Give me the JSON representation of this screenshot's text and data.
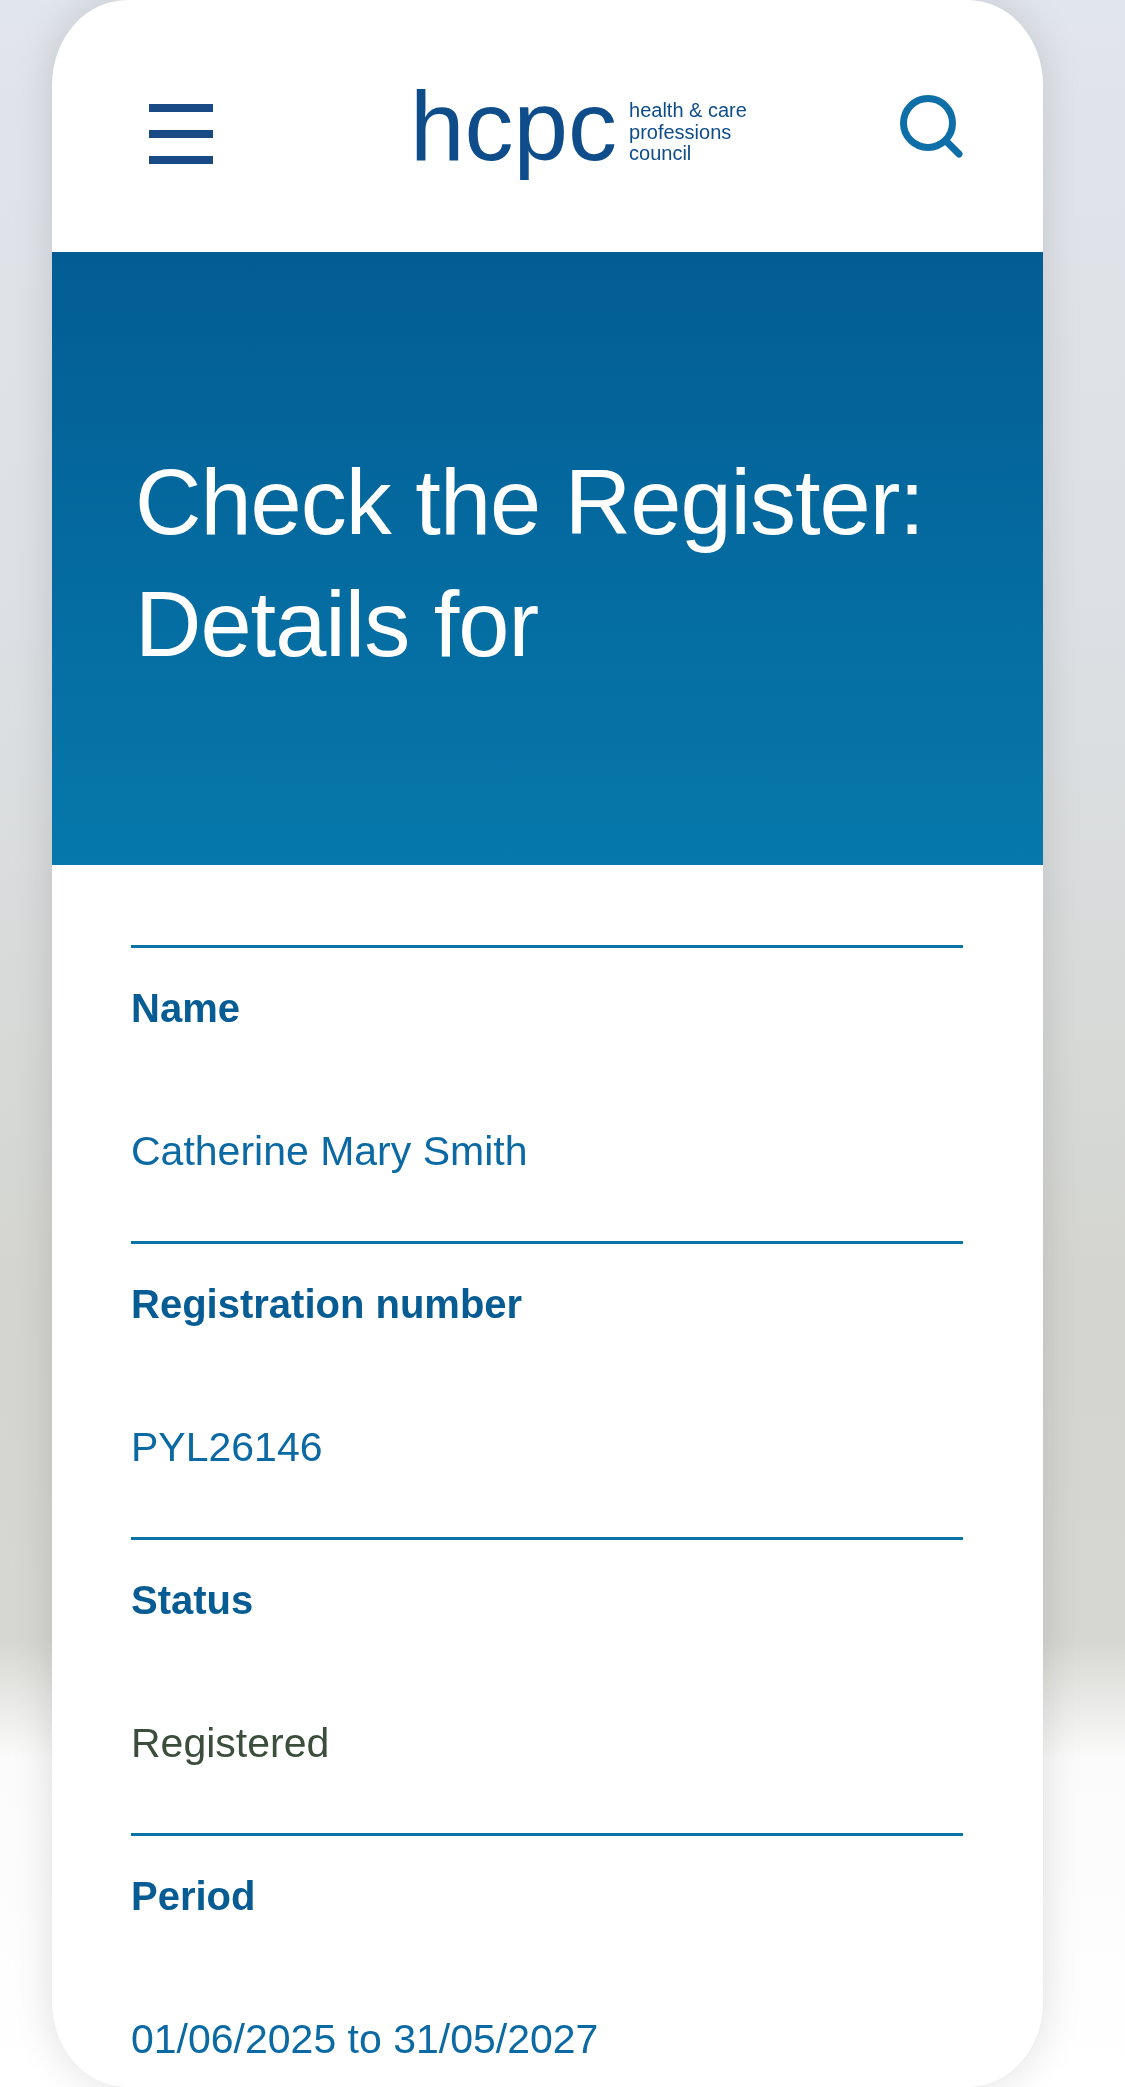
{
  "header": {
    "logo": {
      "wordmark": "hcpc",
      "tagline": [
        "health & care",
        "professions",
        "council"
      ]
    }
  },
  "hero": {
    "title": "Check the Register: Details for"
  },
  "details": [
    {
      "label": "Name",
      "value": "Catherine Mary Smith",
      "color": "#0b69a3"
    },
    {
      "label": "Registration number",
      "value": "PYL26146",
      "color": "#0b69a3"
    },
    {
      "label": "Status",
      "value": "Registered",
      "color": "#3b4e3c"
    },
    {
      "label": "Period",
      "value": "01/06/2025 to 31/05/2027",
      "color": "#0b69a3"
    }
  ]
}
